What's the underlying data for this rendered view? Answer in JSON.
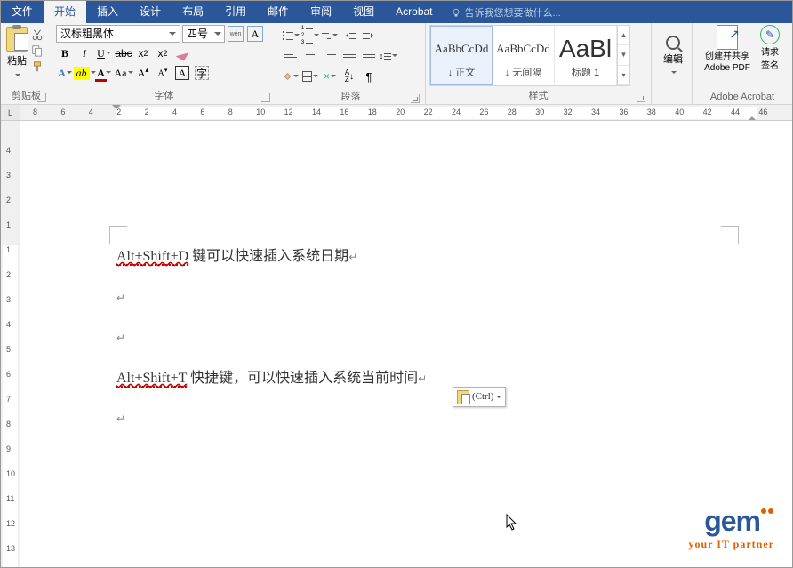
{
  "tabs": {
    "file": "文件",
    "home": "开始",
    "insert": "插入",
    "design": "设计",
    "layout": "布局",
    "references": "引用",
    "mail": "邮件",
    "review": "审阅",
    "view": "视图",
    "acrobat": "Acrobat"
  },
  "tellme": "告诉我您想要做什么...",
  "ribbon": {
    "clipboard": {
      "paste": "粘贴",
      "label": "剪贴板"
    },
    "font": {
      "name": "汉标粗黑体",
      "size": "四号",
      "label": "字体"
    },
    "paragraph": {
      "label": "段落"
    },
    "styles": {
      "preview": "AaBbCcDd",
      "previewBig": "AaBl",
      "normal": "↓ 正文",
      "nospacing": "↓ 无间隔",
      "heading1": "标题 1",
      "label": "样式"
    },
    "editing": {
      "label": "编辑"
    },
    "acrobat": {
      "create_share": "创建并共享",
      "adobe_pdf": "Adobe PDF",
      "request": "请求",
      "signature": "签名",
      "label": "Adobe Acrobat"
    }
  },
  "ruler": {
    "corner": "L",
    "nums": [
      "8",
      "6",
      "4",
      "2",
      "2",
      "4",
      "6",
      "8",
      "10",
      "12",
      "14",
      "16",
      "18",
      "20",
      "22",
      "24",
      "26",
      "28",
      "30",
      "32",
      "34",
      "36",
      "38",
      "40",
      "42",
      "44",
      "46"
    ],
    "vnums": [
      "4",
      "3",
      "2",
      "1",
      "1",
      "2",
      "3",
      "4",
      "5",
      "6",
      "7",
      "8",
      "9",
      "10",
      "11",
      "12",
      "13"
    ]
  },
  "document": {
    "line1_a": "Alt+Shift+D",
    "line1_b": " 键可以快速插入系统日期",
    "line2_a": "Alt+Shift+T",
    "line2_b": " 快捷键，可以快速插入系统当前时间",
    "pmark": "↵"
  },
  "paste_options": "(Ctrl)",
  "logo": {
    "text": "gem",
    "tag": "your IT partner"
  }
}
